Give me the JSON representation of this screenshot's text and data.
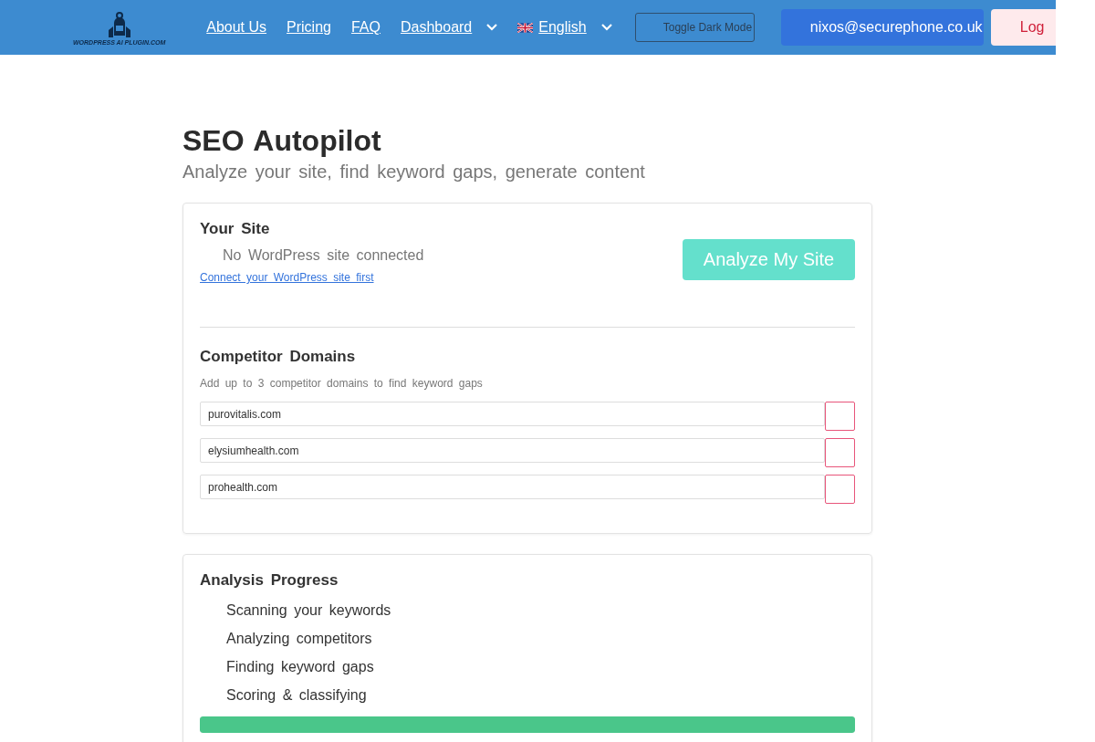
{
  "header": {
    "logo_text": "WORDPRESS AI PLUGIN.COM",
    "nav": [
      {
        "label": "About Us",
        "kind": "link"
      },
      {
        "label": "Pricing",
        "kind": "link"
      },
      {
        "label": "FAQ",
        "kind": "link"
      },
      {
        "label": "Dashboard",
        "kind": "dropdown"
      },
      {
        "label": "English",
        "kind": "language"
      }
    ],
    "dark_mode_button": "Toggle Dark Mode",
    "account_button": "nixos@securephone.co.uk",
    "logout_button": "Log"
  },
  "page": {
    "title": "SEO Autopilot",
    "subtitle": "Analyze your site, find keyword gaps, generate content"
  },
  "site_card": {
    "title": "Your Site",
    "status": "No WordPress site connected",
    "link": "Connect your WordPress site first",
    "analyze_button": "Analyze My Site",
    "competitors_title": "Competitor Domains",
    "competitors_hint": "Add up to 3 competitor domains to find keyword gaps",
    "competitors": [
      {
        "value": "purovitalis.com"
      },
      {
        "value": "elysiumhealth.com"
      },
      {
        "value": "prohealth.com"
      }
    ]
  },
  "progress_card": {
    "title": "Analysis Progress",
    "steps": [
      {
        "label": "Scanning your keywords"
      },
      {
        "label": "Analyzing competitors"
      },
      {
        "label": "Finding keyword gaps"
      },
      {
        "label": "Scoring & classifying"
      }
    ],
    "level": 1
  }
}
